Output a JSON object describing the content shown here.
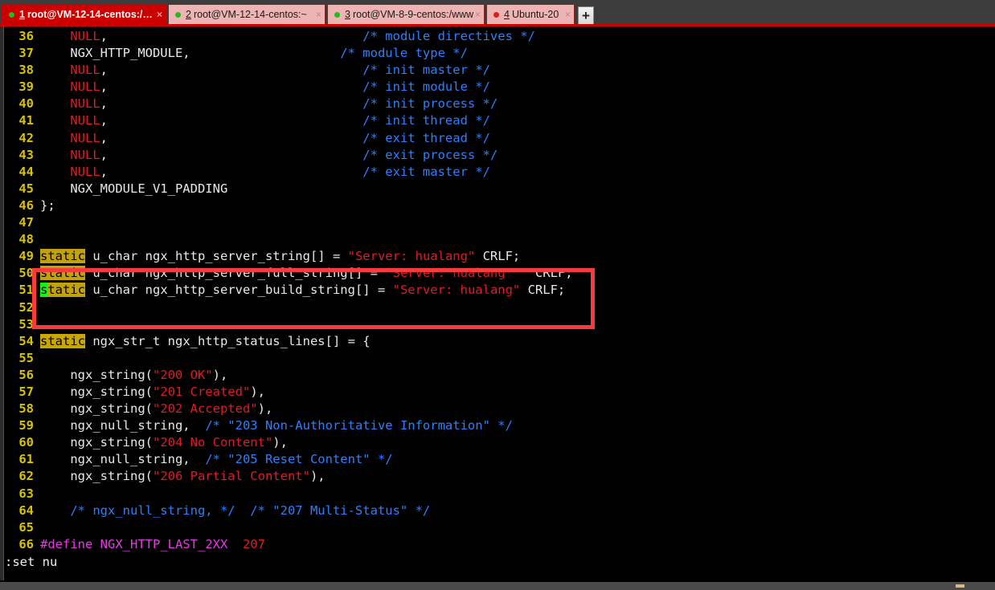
{
  "window": {
    "app": "terminal-emulator",
    "accent_red": "#cc0000",
    "tab_inactive_bg": "#eeb3b3",
    "terminal_bg": "#000000"
  },
  "tabbar": {
    "add_label": "+",
    "close_label": "×",
    "tabs": [
      {
        "num": "1",
        "label": "root@VM-12-14-centos:/…",
        "dot": "green",
        "active": true
      },
      {
        "num": "2",
        "label": "root@VM-12-14-centos:~",
        "dot": "green",
        "active": false
      },
      {
        "num": "3",
        "label": "root@VM-8-9-centos:/www…",
        "dot": "green",
        "active": false
      },
      {
        "num": "4",
        "label": "Ubuntu-20",
        "dot": "red",
        "active": false
      }
    ]
  },
  "editor": {
    "status_line": ":set nu",
    "lines": [
      {
        "num": "36",
        "segs": [
          {
            "t": "    ",
            "c": "def"
          },
          {
            "t": "NULL",
            "c": "const"
          },
          {
            "t": ",",
            "c": "def"
          },
          {
            "t": "                                  ",
            "c": "def"
          },
          {
            "t": "/* module directives */",
            "c": "cmt"
          }
        ]
      },
      {
        "num": "37",
        "segs": [
          {
            "t": "    NGX_HTTP_MODULE,",
            "c": "def"
          },
          {
            "t": "                    ",
            "c": "def"
          },
          {
            "t": "/* module type */",
            "c": "cmt"
          }
        ]
      },
      {
        "num": "38",
        "segs": [
          {
            "t": "    ",
            "c": "def"
          },
          {
            "t": "NULL",
            "c": "const"
          },
          {
            "t": ",",
            "c": "def"
          },
          {
            "t": "                                  ",
            "c": "def"
          },
          {
            "t": "/* init master */",
            "c": "cmt"
          }
        ]
      },
      {
        "num": "39",
        "segs": [
          {
            "t": "    ",
            "c": "def"
          },
          {
            "t": "NULL",
            "c": "const"
          },
          {
            "t": ",",
            "c": "def"
          },
          {
            "t": "                                  ",
            "c": "def"
          },
          {
            "t": "/* init module */",
            "c": "cmt"
          }
        ]
      },
      {
        "num": "40",
        "segs": [
          {
            "t": "    ",
            "c": "def"
          },
          {
            "t": "NULL",
            "c": "const"
          },
          {
            "t": ",",
            "c": "def"
          },
          {
            "t": "                                  ",
            "c": "def"
          },
          {
            "t": "/* init process */",
            "c": "cmt"
          }
        ]
      },
      {
        "num": "41",
        "segs": [
          {
            "t": "    ",
            "c": "def"
          },
          {
            "t": "NULL",
            "c": "const"
          },
          {
            "t": ",",
            "c": "def"
          },
          {
            "t": "                                  ",
            "c": "def"
          },
          {
            "t": "/* init thread */",
            "c": "cmt"
          }
        ]
      },
      {
        "num": "42",
        "segs": [
          {
            "t": "    ",
            "c": "def"
          },
          {
            "t": "NULL",
            "c": "const"
          },
          {
            "t": ",",
            "c": "def"
          },
          {
            "t": "                                  ",
            "c": "def"
          },
          {
            "t": "/* exit thread */",
            "c": "cmt"
          }
        ]
      },
      {
        "num": "43",
        "segs": [
          {
            "t": "    ",
            "c": "def"
          },
          {
            "t": "NULL",
            "c": "const"
          },
          {
            "t": ",",
            "c": "def"
          },
          {
            "t": "                                  ",
            "c": "def"
          },
          {
            "t": "/* exit process */",
            "c": "cmt"
          }
        ]
      },
      {
        "num": "44",
        "segs": [
          {
            "t": "    ",
            "c": "def"
          },
          {
            "t": "NULL",
            "c": "const"
          },
          {
            "t": ",",
            "c": "def"
          },
          {
            "t": "                                  ",
            "c": "def"
          },
          {
            "t": "/* exit master */",
            "c": "cmt"
          }
        ]
      },
      {
        "num": "45",
        "segs": [
          {
            "t": "    NGX_MODULE_V1_PADDING",
            "c": "def"
          }
        ]
      },
      {
        "num": "46",
        "segs": [
          {
            "t": "};",
            "c": "def"
          }
        ]
      },
      {
        "num": "47",
        "segs": []
      },
      {
        "num": "48",
        "segs": []
      },
      {
        "num": "49",
        "segs": [
          {
            "t": "static",
            "c": "kw"
          },
          {
            "t": " u_char ngx_http_server_string[] = ",
            "c": "def"
          },
          {
            "t": "\"Server: hualang\"",
            "c": "str"
          },
          {
            "t": " CRLF;",
            "c": "def"
          }
        ]
      },
      {
        "num": "50",
        "segs": [
          {
            "t": "static",
            "c": "kw"
          },
          {
            "t": " u_char ngx_http_server_full_string[] = ",
            "c": "def"
          },
          {
            "t": "\"Server: hualang \"",
            "c": "str"
          },
          {
            "t": "  CRLF;",
            "c": "def"
          }
        ]
      },
      {
        "num": "51",
        "segs": [
          {
            "t": "s",
            "c": "cursor"
          },
          {
            "t": "tatic",
            "c": "kw"
          },
          {
            "t": " u_char ngx_http_server_build_string[] = ",
            "c": "def"
          },
          {
            "t": "\"Server: hualang\"",
            "c": "str"
          },
          {
            "t": " CRLF;",
            "c": "def"
          }
        ]
      },
      {
        "num": "52",
        "segs": []
      },
      {
        "num": "53",
        "segs": []
      },
      {
        "num": "54",
        "segs": [
          {
            "t": "static",
            "c": "kw"
          },
          {
            "t": " ngx_str_t ngx_http_status_lines[] = {",
            "c": "def"
          }
        ]
      },
      {
        "num": "55",
        "segs": []
      },
      {
        "num": "56",
        "segs": [
          {
            "t": "    ngx_string(",
            "c": "def"
          },
          {
            "t": "\"200 OK\"",
            "c": "str"
          },
          {
            "t": "),",
            "c": "def"
          }
        ]
      },
      {
        "num": "57",
        "segs": [
          {
            "t": "    ngx_string(",
            "c": "def"
          },
          {
            "t": "\"201 Created\"",
            "c": "str"
          },
          {
            "t": "),",
            "c": "def"
          }
        ]
      },
      {
        "num": "58",
        "segs": [
          {
            "t": "    ngx_string(",
            "c": "def"
          },
          {
            "t": "\"202 Accepted\"",
            "c": "str"
          },
          {
            "t": "),",
            "c": "def"
          }
        ]
      },
      {
        "num": "59",
        "segs": [
          {
            "t": "    ngx_null_string,  ",
            "c": "def"
          },
          {
            "t": "/* \"203 Non-Authoritative Information\" */",
            "c": "cmt"
          }
        ]
      },
      {
        "num": "60",
        "segs": [
          {
            "t": "    ngx_string(",
            "c": "def"
          },
          {
            "t": "\"204 No Content\"",
            "c": "str"
          },
          {
            "t": "),",
            "c": "def"
          }
        ]
      },
      {
        "num": "61",
        "segs": [
          {
            "t": "    ngx_null_string,  ",
            "c": "def"
          },
          {
            "t": "/* \"205 Reset Content\" */",
            "c": "cmt"
          }
        ]
      },
      {
        "num": "62",
        "segs": [
          {
            "t": "    ngx_string(",
            "c": "def"
          },
          {
            "t": "\"206 Partial Content\"",
            "c": "str"
          },
          {
            "t": "),",
            "c": "def"
          }
        ]
      },
      {
        "num": "63",
        "segs": []
      },
      {
        "num": "64",
        "segs": [
          {
            "t": "    /* ngx_null_string, */  /* \"207 Multi-Status\" */",
            "c": "cmt"
          }
        ]
      },
      {
        "num": "65",
        "segs": []
      },
      {
        "num": "66",
        "segs": [
          {
            "t": "#define",
            "c": "pre"
          },
          {
            "t": " ",
            "c": "def"
          },
          {
            "t": "NGX_HTTP_LAST_2XX",
            "c": "pre"
          },
          {
            "t": "  ",
            "c": "def"
          },
          {
            "t": "207",
            "c": "num"
          }
        ]
      }
    ]
  },
  "annotation": {
    "shape": "rectangle",
    "color": "#fb3b3b",
    "covers_lines": "49-51"
  }
}
